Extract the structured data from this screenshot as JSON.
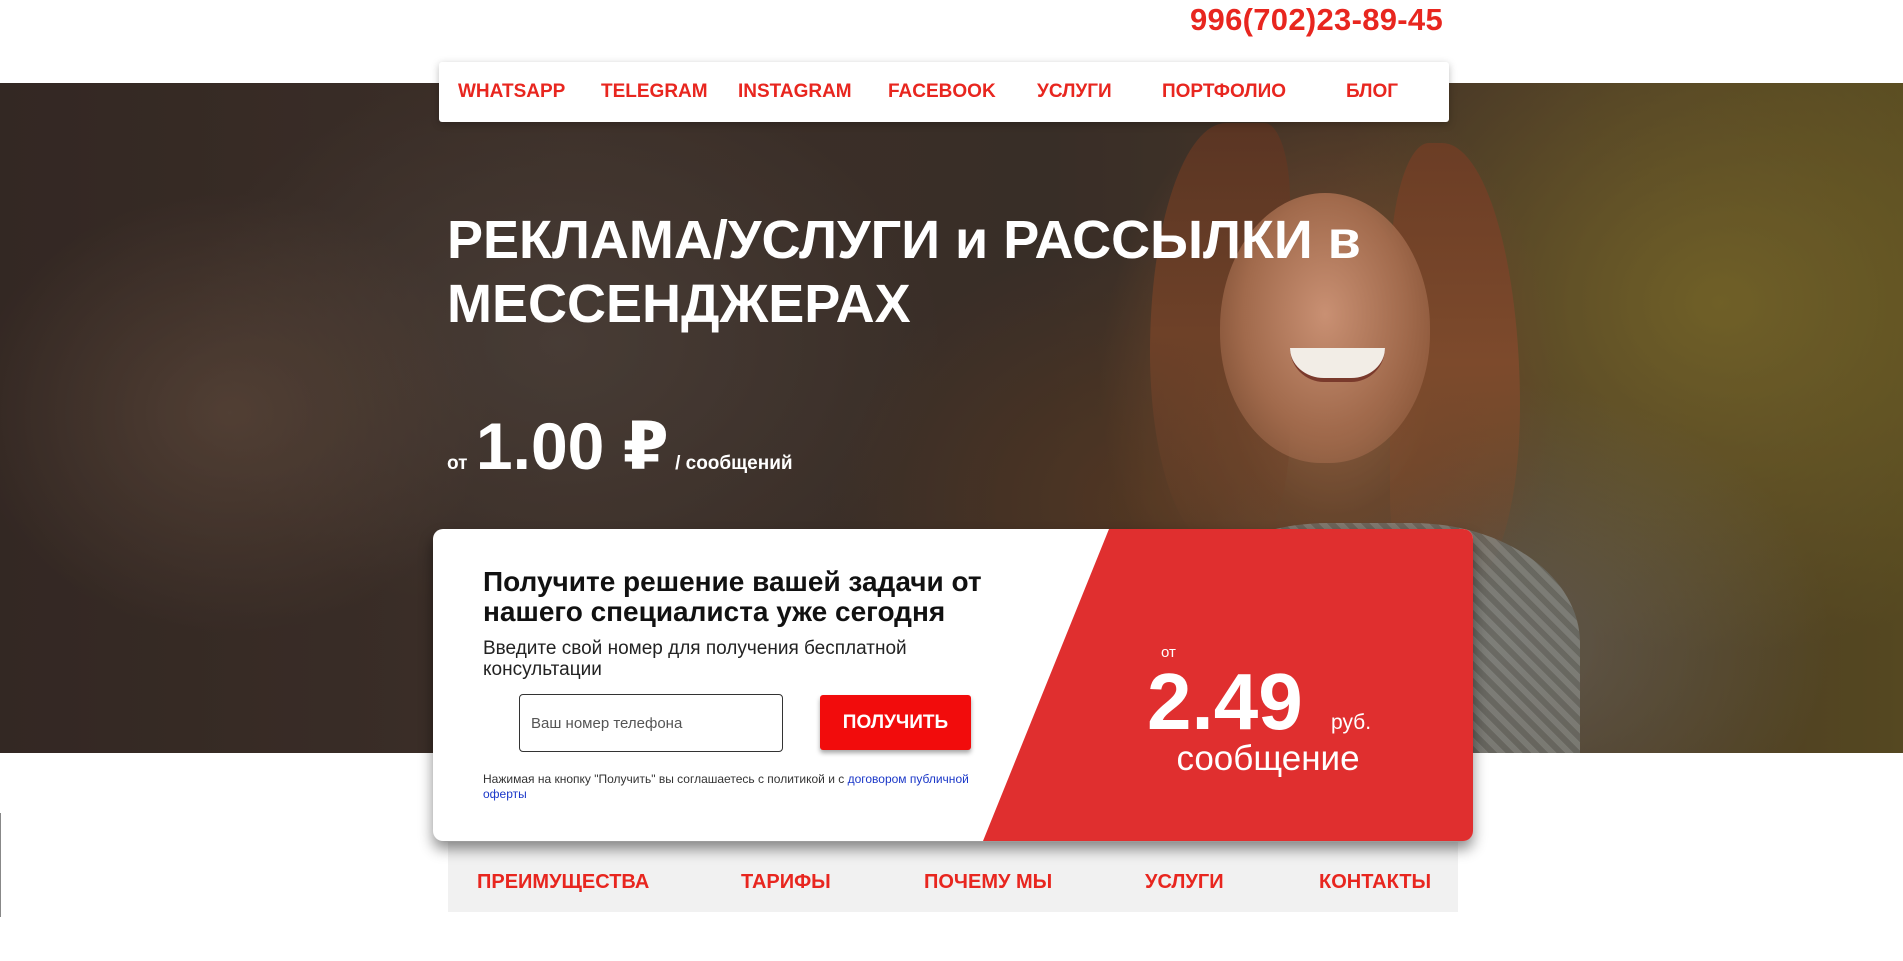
{
  "header": {
    "phone": "996(702)23-89-45"
  },
  "top_nav": {
    "items": [
      {
        "label": "WHATSAPP"
      },
      {
        "label": "TELEGRAM"
      },
      {
        "label": "INSTAGRAM"
      },
      {
        "label": "FACEBOOK"
      },
      {
        "label": "УСЛУГИ"
      },
      {
        "label": "ПОРТФОЛИО"
      },
      {
        "label": "БЛОГ"
      }
    ]
  },
  "hero": {
    "headline": "РЕКЛАМА/УСЛУГИ и РАССЫЛКИ в МЕССЕНДЖЕРАХ",
    "price_prefix": "от",
    "price_value": "1.00 ₽",
    "price_unit": "/ сообщений"
  },
  "lead_form": {
    "title": "Получите решение вашей задачи от нашего специалиста уже сегодня",
    "subtitle": "Введите свой номер для получения бесплатной консультации",
    "phone_placeholder": "Ваш номер телефона",
    "phone_value": "",
    "submit_label": "ПОЛУЧИТЬ",
    "disclaimer_text": "Нажимая на кнопку \"Получить\" вы соглашаетесь с политикой и с ",
    "disclaimer_link": "договором публичной оферты"
  },
  "promo": {
    "prefix": "от",
    "price": "2.49",
    "unit": "руб.",
    "per": "сообщение"
  },
  "bottom_nav": {
    "items": [
      {
        "label": "ПРЕИМУЩЕСТВА"
      },
      {
        "label": "ТАРИФЫ"
      },
      {
        "label": "ПОЧЕМУ МЫ"
      },
      {
        "label": "УСЛУГИ"
      },
      {
        "label": "КОНТАКТЫ"
      }
    ]
  },
  "colors": {
    "accent": "#e8261f",
    "promo_panel": "#e02f2f",
    "button": "#f20c0c",
    "link": "#1a37c8"
  }
}
